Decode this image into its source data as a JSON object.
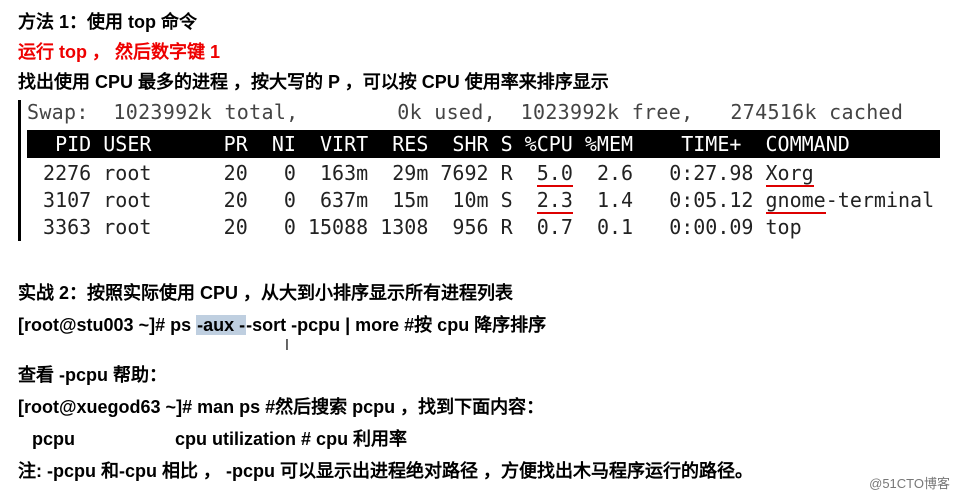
{
  "headings": {
    "method1": "方法 1：使用 top 命令",
    "runTop": "运行 top ， 然后数字键 1",
    "findCpu": "找出使用 CPU 最多的进程 ，按大写的 P ，可以按 CPU 使用率来排序显示"
  },
  "swap_line": "Swap:  1023992k total,        0k used,  1023992k free,   274516k cached",
  "top_header": "  PID USER      PR  NI  VIRT  RES  SHR S %CPU %MEM    TIME+  COMMAND     ",
  "top_rows": [
    {
      "pre": " 2276 root      20   0  163m  29m 7692 R  ",
      "cpu": "5.0",
      "mid": "  2.6   0:27.98 ",
      "cmd": "Xorg",
      "tail": ""
    },
    {
      "pre": " 3107 root      20   0  637m  15m  10m S  ",
      "cpu": "2.3",
      "mid": "  1.4   0:05.12 ",
      "cmd": "gnome",
      "tail": "-terminal"
    },
    {
      "pre": " 3363 root      20   0 15088 1308  956 R  ",
      "cpu": "0.7",
      "mid": "  0.1   0:00.09 ",
      "cmd": "top",
      "tail": ""
    }
  ],
  "practice2": "实战 2：按照实际使用 CPU ，从大到小排序显示所有进程列表",
  "cmd1_prompt": "[root@stu003 ~]# ",
  "cmd1_cmd": "ps ",
  "cmd1_hl": "-aux -",
  "cmd1_rest": "-sort -pcpu | more",
  "cmd1_comment": "    #按 cpu 降序排序",
  "help_line": "查看  -pcpu 帮助：",
  "cmd2_prompt": "[root@xuegod63 ~]# ",
  "cmd2_cmd": "man ps",
  "cmd2_comment": "   #然后搜索  pcpu    ，找到下面内容：",
  "pcpu_label": "pcpu",
  "pcpu_desc": "cpu utilization",
  "pcpu_comment": "   #  cpu 利用率",
  "note": "注:   -pcpu  和-cpu  相比 ，   -pcpu  可以显示出进程绝对路径 ，方便找出木马程序运行的路径。",
  "watermark": "@51CTO博客"
}
